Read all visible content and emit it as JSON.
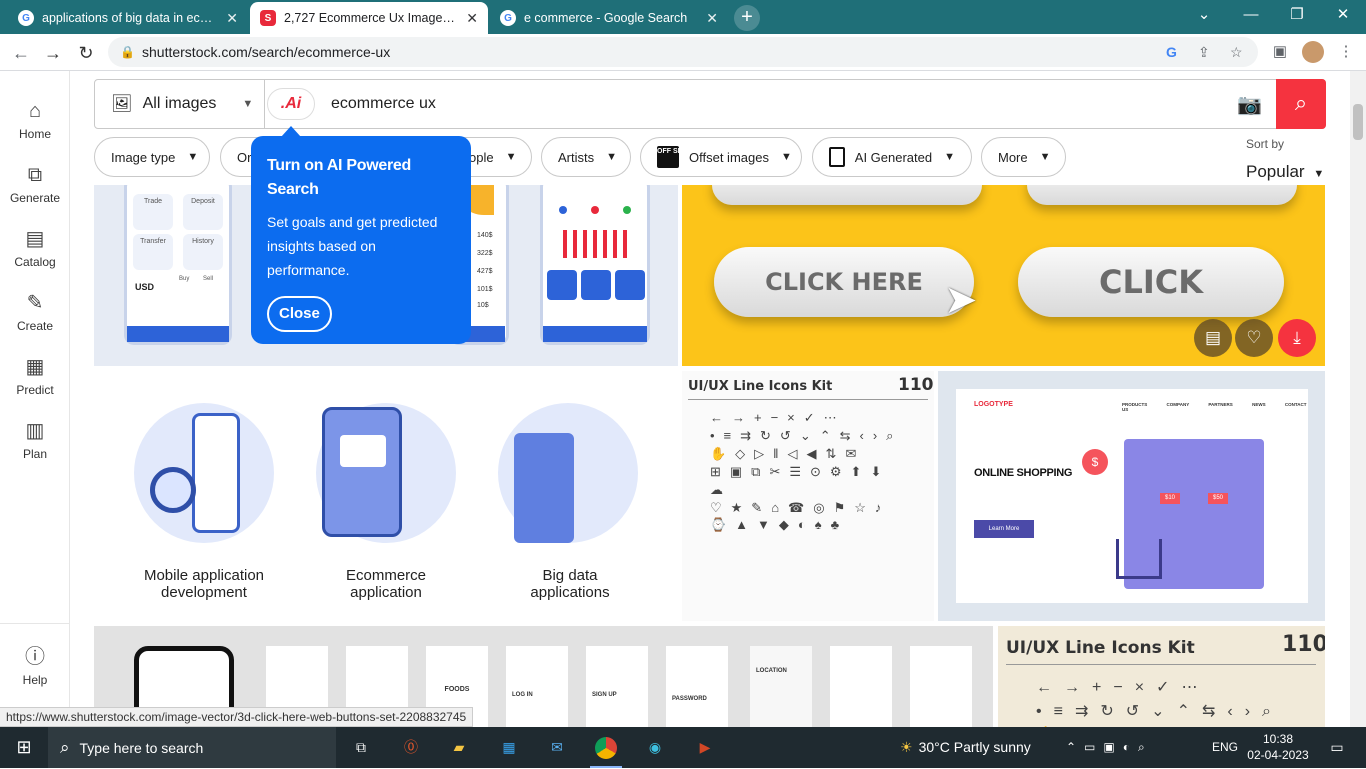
{
  "browser": {
    "tabs": [
      {
        "title": "applications of big data in ecomm",
        "icon": "google-icon"
      },
      {
        "title": "2,727 Ecommerce Ux Images, Sto",
        "icon": "shutterstock-icon"
      },
      {
        "title": "e commerce - Google Search",
        "icon": "google-icon"
      }
    ],
    "url": "shutterstock.com/search/ecommerce-ux",
    "status_url": "https://www.shutterstock.com/image-vector/3d-click-here-web-buttons-set-2208832745"
  },
  "sidebar": {
    "items": [
      {
        "label": "Home"
      },
      {
        "label": "Generate"
      },
      {
        "label": "Catalog"
      },
      {
        "label": "Create"
      },
      {
        "label": "Predict"
      },
      {
        "label": "Plan"
      }
    ],
    "help": "Help"
  },
  "search": {
    "type_label": "All images",
    "ai_label": ".Ai",
    "query": "ecommerce ux"
  },
  "filters": {
    "image_type": "Image type",
    "orientation": "Ori",
    "people": "ople",
    "artists": "Artists",
    "offset": "Offset images",
    "offset_badge": "OFF SET",
    "ai": "AI Generated",
    "more": "More",
    "sort_label": "Sort by",
    "sort_value": "Popular"
  },
  "tooltip": {
    "title": "Turn on AI Powered Search",
    "body": "Set goals and get predicted insights based on performance.",
    "close": "Close"
  },
  "images": {
    "finance_values": [
      "140$",
      "322$",
      "427$",
      "101$",
      "10$"
    ],
    "finance_labels": {
      "usd": "USD",
      "trade": "Trade",
      "deposit": "Deposit",
      "transfer": "Transfer",
      "history": "History",
      "buy": "Buy",
      "sell": "Sell"
    },
    "buttons": {
      "left": "CLICK HERE",
      "right": "CLICK"
    },
    "illustrations": [
      {
        "caption1": "Mobile application",
        "caption2": "development"
      },
      {
        "caption1": "Ecommerce",
        "caption2": "application"
      },
      {
        "caption1": "Big data",
        "caption2": "applications"
      }
    ],
    "icons_kit": {
      "title": "UI/UX Line Icons Kit",
      "count": "110"
    },
    "shop": {
      "logo": "LOGOTYPE",
      "nav": [
        "PRODUCTS",
        "COMPANY",
        "PARTNERS",
        "NEWS",
        "CONTACT US"
      ],
      "heading": "ONLINE SHOPPING",
      "cta": "Learn More",
      "prices": [
        "$10",
        "$50"
      ]
    },
    "app_screens": [
      "FOODS",
      "LOG IN",
      "SIGN UP",
      "PASSWORD",
      "LOCATION"
    ]
  },
  "taskbar": {
    "search": "Type here to search",
    "weather": "30°C  Partly sunny",
    "lang": "ENG",
    "time": "10:38",
    "date": "02-04-2023"
  }
}
